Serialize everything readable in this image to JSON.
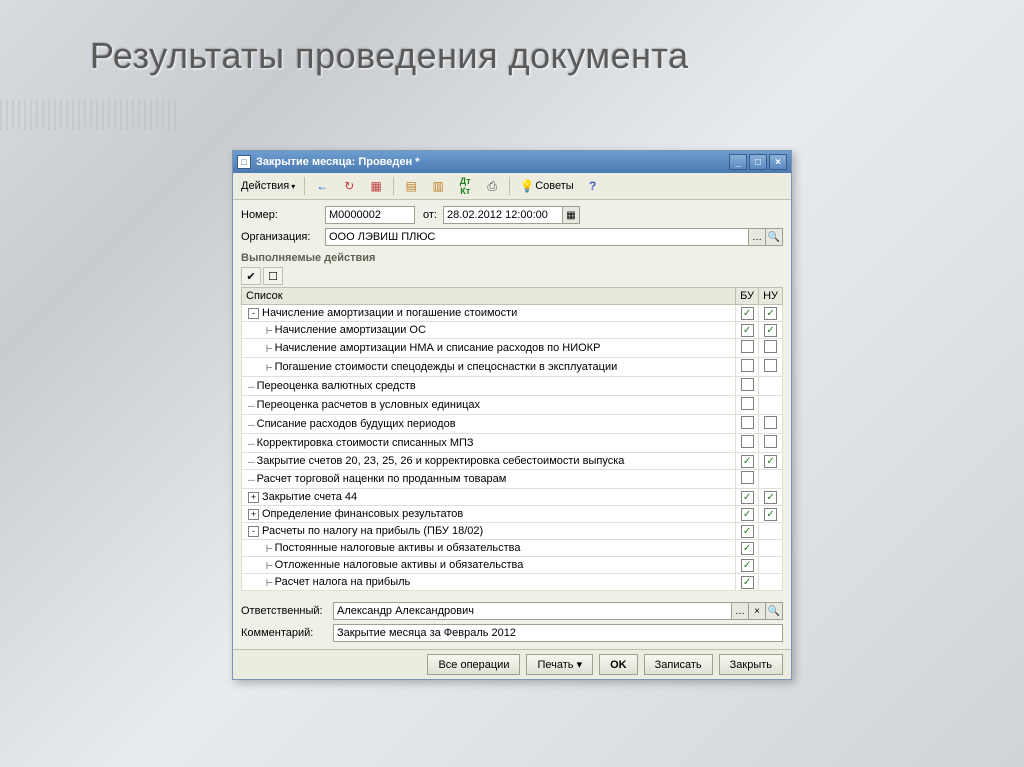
{
  "slide": {
    "title": "Результаты проведения документа"
  },
  "window": {
    "title": "Закрытие месяца: Проведен *"
  },
  "toolbar": {
    "actions": "Действия",
    "tips": "Советы"
  },
  "form": {
    "number_label": "Номер:",
    "number": "М0000002",
    "from_label": "от:",
    "date": "28.02.2012 12:00:00",
    "org_label": "Организация:",
    "org": "ООО ЛЭВИШ ПЛЮС"
  },
  "section": {
    "title": "Выполняемые действия"
  },
  "table": {
    "col_list": "Список",
    "col_bu": "БУ",
    "col_nu": "НУ",
    "rows": [
      {
        "indent": 0,
        "toggle": "-",
        "label": "Начисление амортизации и погашение стоимости",
        "bu": true,
        "nu": true
      },
      {
        "indent": 1,
        "branch": true,
        "label": "Начисление амортизации ОС",
        "bu": true,
        "nu": true
      },
      {
        "indent": 1,
        "branch": true,
        "label": "Начисление амортизации НМА и списание расходов по НИОКР",
        "bu": false,
        "nu": false
      },
      {
        "indent": 1,
        "branch": true,
        "label": "Погашение стоимости спецодежды и спецоснастки в эксплуатации",
        "bu": false,
        "nu": false
      },
      {
        "indent": 0,
        "leaf": true,
        "label": "Переоценка валютных средств",
        "bu": false,
        "nu": null
      },
      {
        "indent": 0,
        "leaf": true,
        "label": "Переоценка расчетов в условных единицах",
        "bu": false,
        "nu": null
      },
      {
        "indent": 0,
        "leaf": true,
        "label": "Списание расходов будущих периодов",
        "bu": false,
        "nu": false
      },
      {
        "indent": 0,
        "leaf": true,
        "label": "Корректировка стоимости списанных МПЗ",
        "bu": false,
        "nu": false
      },
      {
        "indent": 0,
        "leaf": true,
        "label": "Закрытие счетов 20, 23, 25, 26 и корректировка себестоимости выпуска",
        "bu": true,
        "nu": true
      },
      {
        "indent": 0,
        "leaf": true,
        "label": "Расчет торговой наценки по проданным товарам",
        "bu": false,
        "nu": null
      },
      {
        "indent": 0,
        "toggle": "+",
        "label": "Закрытие счета 44",
        "bu": true,
        "nu": true
      },
      {
        "indent": 0,
        "toggle": "+",
        "label": "Определение финансовых результатов",
        "bu": true,
        "nu": true
      },
      {
        "indent": 0,
        "toggle": "-",
        "label": "Расчеты по налогу на прибыль (ПБУ 18/02)",
        "bu": true,
        "nu": null
      },
      {
        "indent": 1,
        "branch": true,
        "label": "Постоянные налоговые активы и обязательства",
        "bu": true,
        "nu": null
      },
      {
        "indent": 1,
        "branch": true,
        "label": "Отложенные налоговые активы и обязательства",
        "bu": true,
        "nu": null
      },
      {
        "indent": 1,
        "branch": true,
        "label": "Расчет налога на прибыль",
        "bu": true,
        "nu": null
      }
    ]
  },
  "bottom": {
    "resp_label": "Ответственный:",
    "responsible": "Александр Александрович",
    "comment_label": "Комментарий:",
    "comment": "Закрытие месяца за Февраль 2012"
  },
  "buttons": {
    "all_ops": "Все операции",
    "print": "Печать",
    "ok": "OK",
    "save": "Записать",
    "close": "Закрыть"
  }
}
